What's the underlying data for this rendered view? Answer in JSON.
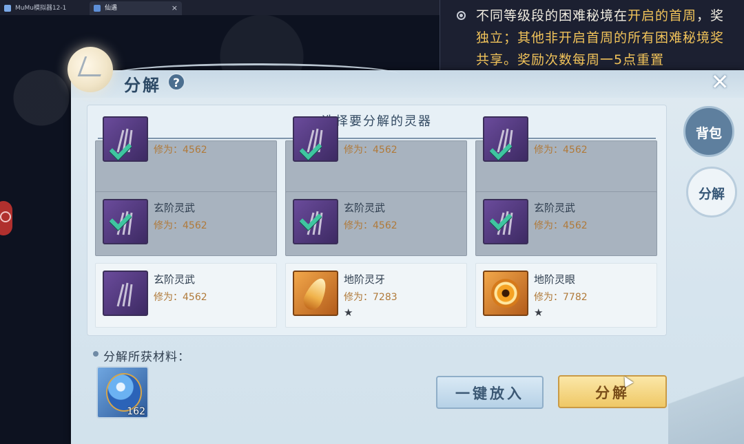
{
  "browser": {
    "tabs": [
      {
        "label": "MuMu模拟器12-1"
      },
      {
        "label": "仙遇"
      }
    ],
    "close_glyph": "×"
  },
  "tooltip": {
    "line1_pre": "不同等级段的困难秘境在",
    "line1_hl": "开启的首周",
    "line1_post": "，奖",
    "line2_pre": "独立；其他",
    "line2_hl": "非开启首周",
    "line2_post": "的所有困难秘境奖",
    "line3": "共享。奖励次数每周一5点重置",
    "bullet_icon": "radio-bullet-icon"
  },
  "panel": {
    "title": "分解",
    "help_label": "?",
    "close_label": "✕",
    "list_title": "选择要分解的灵器",
    "items": [
      {
        "name": "",
        "stat": "修为：4562",
        "selected": true,
        "icon": "claw-weapon-icon",
        "star": ""
      },
      {
        "name": "",
        "stat": "修为：4562",
        "selected": true,
        "icon": "claw-weapon-icon",
        "star": ""
      },
      {
        "name": "",
        "stat": "修为：4562",
        "selected": true,
        "icon": "claw-weapon-icon",
        "star": ""
      },
      {
        "name": "玄阶灵武",
        "stat": "修为：4562",
        "selected": true,
        "icon": "claw-weapon-icon",
        "star": ""
      },
      {
        "name": "玄阶灵武",
        "stat": "修为：4562",
        "selected": true,
        "icon": "claw-weapon-icon",
        "star": ""
      },
      {
        "name": "玄阶灵武",
        "stat": "修为：4562",
        "selected": true,
        "icon": "claw-weapon-icon",
        "star": ""
      },
      {
        "name": "玄阶灵武",
        "stat": "修为：4562",
        "selected": false,
        "icon": "claw-weapon-icon",
        "star": ""
      },
      {
        "name": "地阶灵牙",
        "stat": "修为：7283",
        "selected": false,
        "icon": "fang-icon",
        "star": "★"
      },
      {
        "name": "地阶灵眼",
        "stat": "修为：7782",
        "selected": false,
        "icon": "eye-icon",
        "star": "★"
      }
    ],
    "side_tabs": [
      {
        "label": "背包",
        "active": false
      },
      {
        "label": "分解",
        "active": true
      }
    ],
    "materials_label": "分解所获材料：",
    "material": {
      "icon": "spirit-orb-icon",
      "count": "162"
    },
    "buttons": {
      "put_all": "一键放入",
      "decompose": "分解"
    }
  },
  "colors": {
    "accent": "#f1c35a",
    "selected_bg": "#a8b3bf",
    "check": "#3fc5a0",
    "stat_text": "#b07a3a"
  }
}
